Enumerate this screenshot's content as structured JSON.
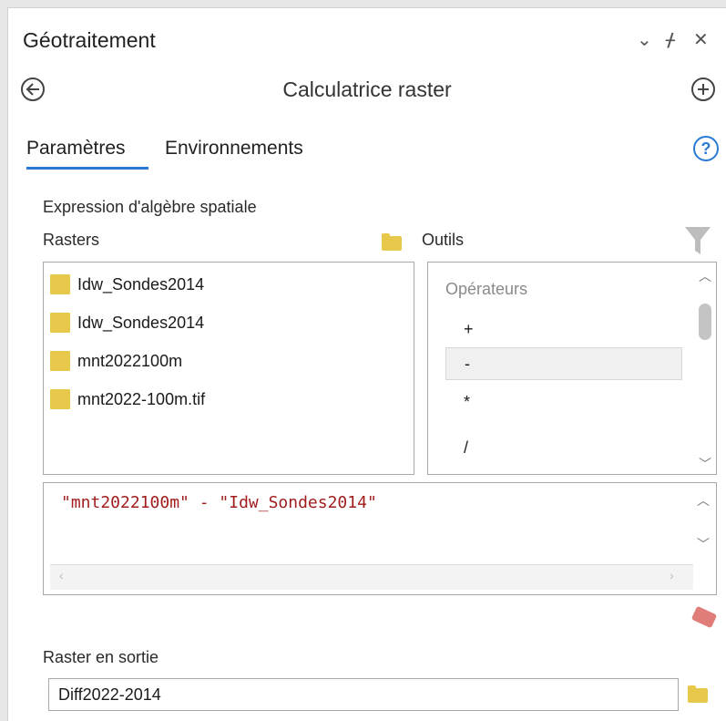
{
  "header": {
    "title": "Géotraitement",
    "collapse_icon": "chevron-down",
    "pin_icon": "pin",
    "close_icon": "close"
  },
  "tool": {
    "name": "Calculatrice raster",
    "back_icon": "back-arrow",
    "add_icon": "plus"
  },
  "tabs": {
    "parametres": "Paramètres",
    "environnements": "Environnements",
    "active": "Paramètres"
  },
  "form": {
    "expression_label": "Expression d'algèbre spatiale",
    "rasters_label": "Rasters",
    "outils_label": "Outils",
    "rasters": [
      "Idw_Sondes2014",
      "Idw_Sondes2014",
      "mnt2022100m",
      "mnt2022-100m.tif"
    ],
    "operators_header": "Opérateurs",
    "operators": [
      "+",
      "-",
      "*",
      "/"
    ],
    "selected_operator": "-",
    "expression": "\"mnt2022100m\" - \"Idw_Sondes2014\"",
    "output_label": "Raster en sortie",
    "output_value": "Diff2022-2014"
  },
  "colors": {
    "accent": "#2b7bd4",
    "folder": "#e8c84a",
    "expression_text": "#a11d1d",
    "eraser": "#e07d78"
  }
}
